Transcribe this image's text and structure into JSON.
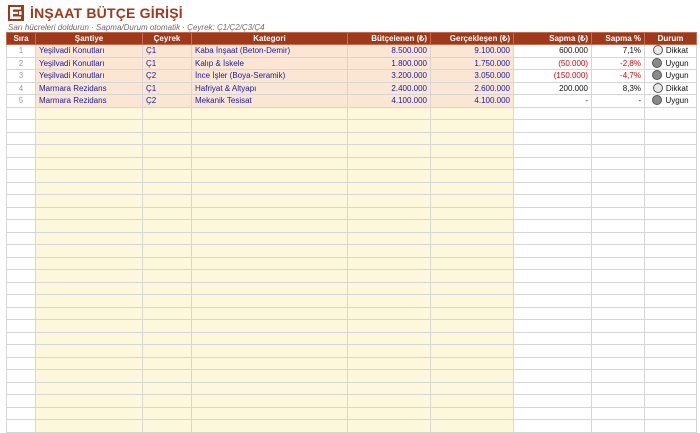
{
  "header": {
    "title": "İNŞAAT BÜTÇE GİRİŞİ",
    "subtitle": "Sarı hücreleri doldurun · Sapma/Durum otomatik · Çeyrek: Ç1/Ç2/Ç3/Ç4",
    "logo_icon": "construction-logo-icon"
  },
  "columns": [
    "Sıra",
    "Şantiye",
    "Çeyrek",
    "Kategori",
    "Bütçelenen (₺)",
    "Gerçekleşen (₺)",
    "Sapma (₺)",
    "Sapma %",
    "Durum"
  ],
  "rows": [
    {
      "idx": "1",
      "site": "Yeşilvadi Konutları",
      "quarter": "Ç1",
      "category": "Kaba İnşaat (Beton-Demir)",
      "budget": "8.500.000",
      "actual": "9.100.000",
      "variance": "600.000",
      "variance_pct": "7,1%",
      "status": "Dikkat",
      "status_color": "#e8e8e8"
    },
    {
      "idx": "2",
      "site": "Yeşilvadi Konutları",
      "quarter": "Ç1",
      "category": "Kalıp & İskele",
      "budget": "1.800.000",
      "actual": "1.750.000",
      "variance": "(50.000)",
      "variance_pct": "-2,8%",
      "status": "Uygun",
      "status_color": "#8a8a8a"
    },
    {
      "idx": "3",
      "site": "Yeşilvadi Konutları",
      "quarter": "Ç2",
      "category": "İnce İşler (Boya-Seramik)",
      "budget": "3.200.000",
      "actual": "3.050.000",
      "variance": "(150.000)",
      "variance_pct": "-4,7%",
      "status": "Uygun",
      "status_color": "#8a8a8a"
    },
    {
      "idx": "4",
      "site": "Marmara Rezidans",
      "quarter": "Ç1",
      "category": "Hafriyat & Altyapı",
      "budget": "2.400.000",
      "actual": "2.600.000",
      "variance": "200.000",
      "variance_pct": "8,3%",
      "status": "Dikkat",
      "status_color": "#e8e8e8"
    },
    {
      "idx": "5",
      "site": "Marmara Rezidans",
      "quarter": "Ç2",
      "category": "Mekanik Tesisat",
      "budget": "4.100.000",
      "actual": "4.100.000",
      "variance": "-",
      "variance_pct": "-",
      "status": "Uygun",
      "status_color": "#8a8a8a"
    }
  ],
  "colors": {
    "accent": "#a0391a",
    "input_text": "#1a1ab0",
    "negative": "#e00000",
    "input_fill": "#fbe5d3",
    "empty_input_fill": "#fdf8dc"
  }
}
